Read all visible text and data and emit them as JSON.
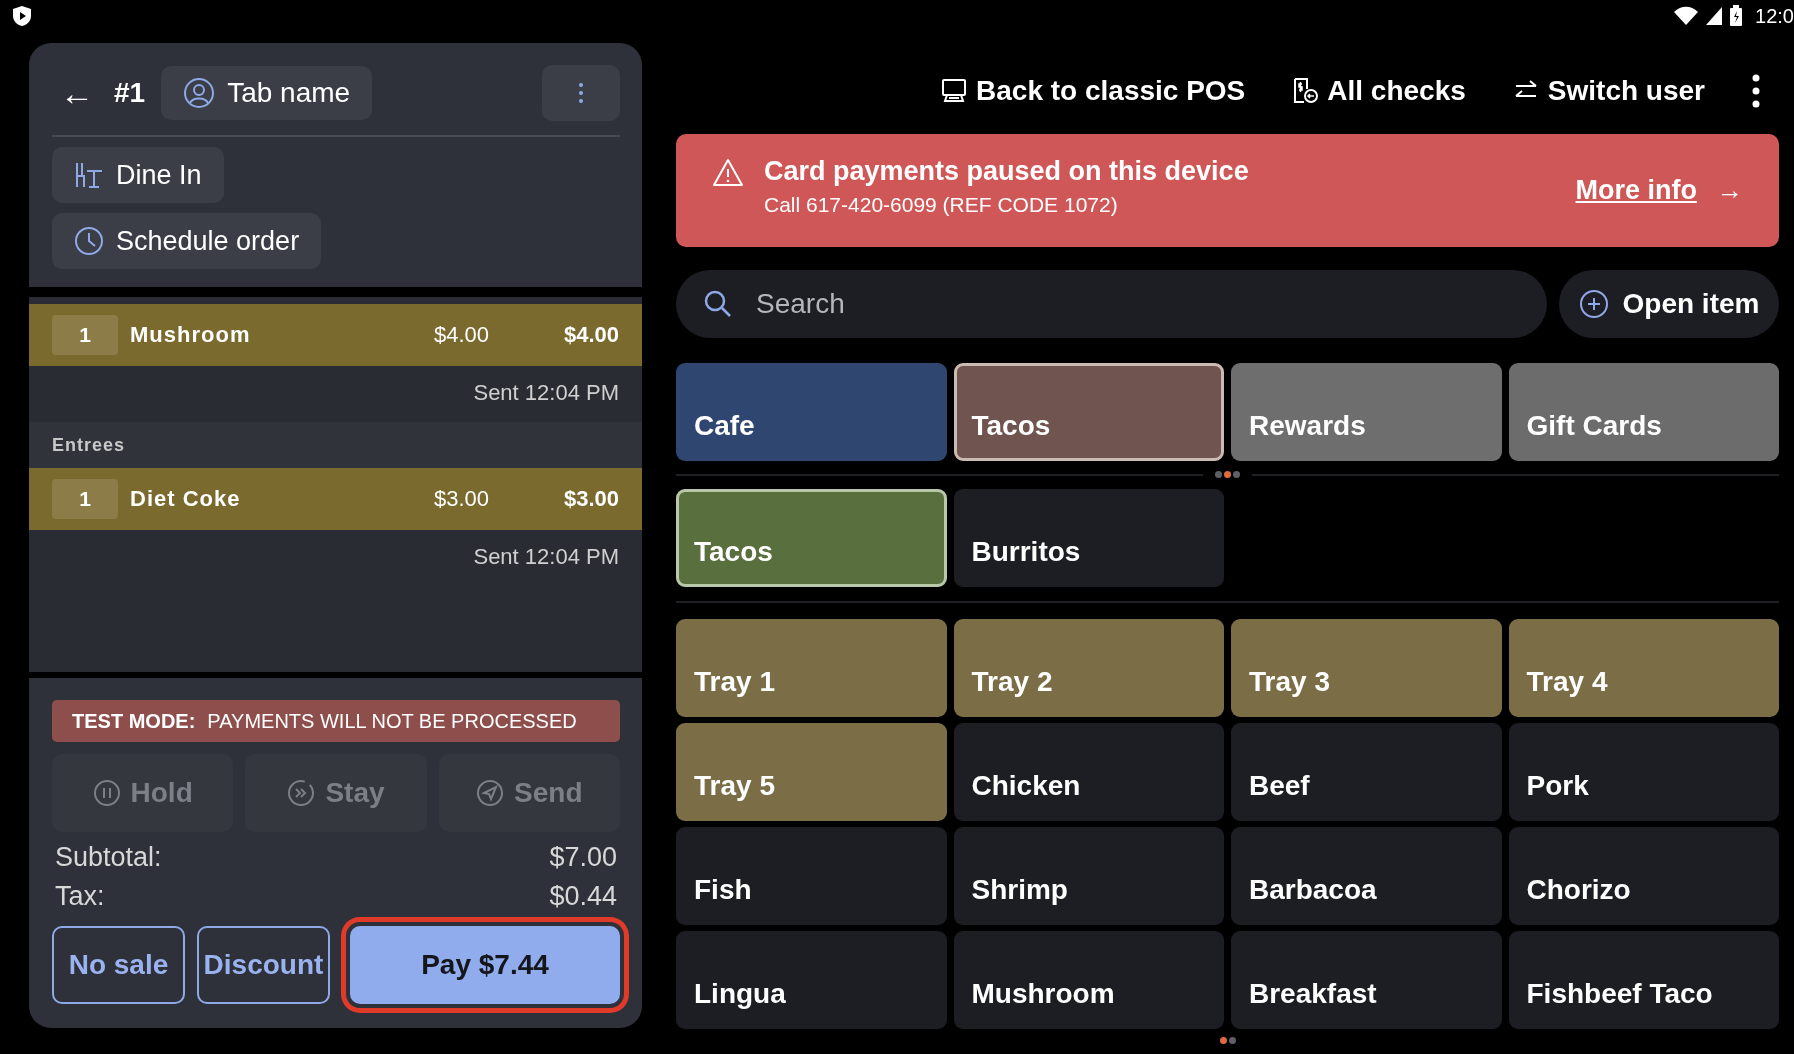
{
  "status_bar": {
    "time": "12:0"
  },
  "order": {
    "back": "←",
    "number": "#1",
    "tab_name": "Tab name",
    "dining_option": "Dine In",
    "schedule": "Schedule order",
    "items": [
      {
        "kind": "item",
        "qty": "1",
        "name": "Mushroom",
        "price": "$4.00",
        "total": "$4.00",
        "sent": "Sent 12:04 PM"
      },
      {
        "kind": "section",
        "name": "Entrees"
      },
      {
        "kind": "item",
        "qty": "1",
        "name": "Diet Coke",
        "price": "$3.00",
        "total": "$3.00",
        "sent": "Sent 12:04 PM"
      }
    ],
    "test_mode": {
      "label": "TEST MODE:",
      "message": "PAYMENTS WILL NOT BE PROCESSED"
    },
    "actions": [
      {
        "kind": "hold",
        "label": "Hold",
        "disabled": true
      },
      {
        "kind": "stay",
        "label": "Stay",
        "disabled": true
      },
      {
        "kind": "send",
        "label": "Send",
        "disabled": true
      }
    ],
    "totals": [
      {
        "label": "Subtotal:",
        "value": "$7.00"
      },
      {
        "label": "Tax:",
        "value": "$0.44"
      }
    ],
    "buttons": [
      {
        "kind": "outline",
        "label": "No sale"
      },
      {
        "kind": "outline",
        "label": "Discount"
      },
      {
        "kind": "primary",
        "label": "Pay $7.44"
      }
    ]
  },
  "toolbar": [
    {
      "kind": "pos",
      "label": "Back to classic POS"
    },
    {
      "kind": "checks",
      "label": "All checks"
    },
    {
      "kind": "switch",
      "label": "Switch user"
    }
  ],
  "alert": {
    "title": "Card payments paused on this device",
    "detail": "Call 617-420-6099 (REF CODE 1072)",
    "link": "More info",
    "arrow": "→"
  },
  "search": {
    "placeholder": "Search"
  },
  "open_item": "Open item",
  "categories": [
    {
      "label": "Cafe",
      "color": "#2f4770",
      "selected": false
    },
    {
      "label": "Tacos",
      "color": "#705450",
      "selected": true
    },
    {
      "label": "Rewards",
      "color": "#6e6e6e",
      "selected": false
    },
    {
      "label": "Gift Cards",
      "color": "#6c6c6c",
      "selected": false
    }
  ],
  "category_pager": [
    {
      "selected": false
    },
    {
      "selected": true
    },
    {
      "selected": false
    }
  ],
  "subcategories": [
    {
      "label": "Tacos",
      "color": "#5a6f3e",
      "selected": true
    },
    {
      "label": "Burritos",
      "color": "#1c1e23",
      "selected": false
    }
  ],
  "menu_items": [
    {
      "label": "Tray 1",
      "color": "#7b6e47"
    },
    {
      "label": "Tray 2",
      "color": "#7b6e47"
    },
    {
      "label": "Tray 3",
      "color": "#7b6e47"
    },
    {
      "label": "Tray 4",
      "color": "#7b6e47"
    },
    {
      "label": "Tray 5",
      "color": "#7b6e47"
    },
    {
      "label": "Chicken",
      "color": "#1c1e23"
    },
    {
      "label": "Beef",
      "color": "#1c1e23"
    },
    {
      "label": "Pork",
      "color": "#1c1e23"
    },
    {
      "label": "Fish",
      "color": "#1c1e23"
    },
    {
      "label": "Shrimp",
      "color": "#1c1e23"
    },
    {
      "label": "Barbacoa",
      "color": "#1c1e23"
    },
    {
      "label": "Chorizo",
      "color": "#1c1e23"
    },
    {
      "label": "Lingua",
      "color": "#1c1e23"
    },
    {
      "label": "Mushroom",
      "color": "#1c1e23"
    },
    {
      "label": "Breakfast",
      "color": "#1c1e23"
    },
    {
      "label": "Fishbeef Taco",
      "color": "#1c1e23"
    }
  ],
  "menu_pager": [
    {
      "selected": true
    },
    {
      "selected": false
    }
  ]
}
